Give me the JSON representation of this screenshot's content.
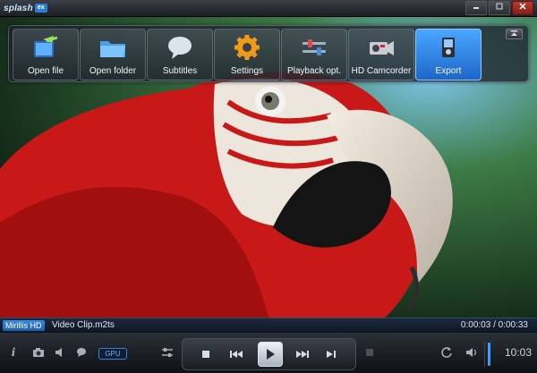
{
  "app": {
    "logo_text": "splash",
    "logo_badge": "ex"
  },
  "window_buttons": [
    {
      "icon": "minimize-icon"
    },
    {
      "icon": "maximize-icon"
    },
    {
      "icon": "close-icon"
    }
  ],
  "menu": {
    "items": [
      {
        "label": "Open file",
        "icon": "open-file-icon"
      },
      {
        "label": "Open folder",
        "icon": "folder-icon"
      },
      {
        "label": "Subtitles",
        "icon": "speech-bubble-icon"
      },
      {
        "label": "Settings",
        "icon": "gear-icon"
      },
      {
        "label": "Playback opt.",
        "icon": "slider-icon"
      },
      {
        "label": "HD Camcorder",
        "icon": "camcorder-icon"
      },
      {
        "label": "Export",
        "icon": "export-icon",
        "active": true
      }
    ]
  },
  "info_bar": {
    "brand": "Mirillis HD",
    "file_name": "Video Clip.m2ts",
    "time": "0:00:03 / 0:00:33"
  },
  "controls": {
    "gpu_label": "GPU",
    "clock": "10:03"
  },
  "colors": {
    "accent": "#2d7fd1",
    "active_menu": "#3a8be0"
  }
}
